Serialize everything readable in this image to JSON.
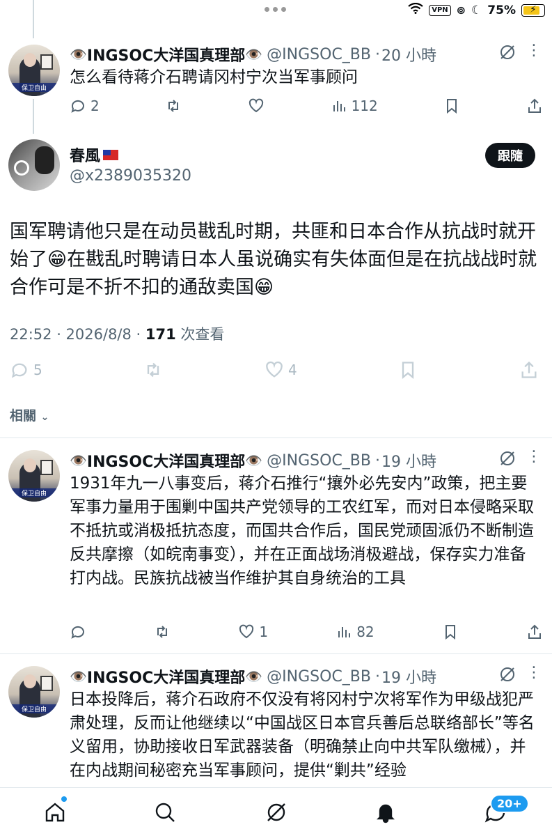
{
  "status_bar": {
    "vpn": "VPN",
    "battery": "75%"
  },
  "tweets_top": {
    "name": "INGSOC大洋国真理部",
    "handle": "@INGSOC_BB",
    "time": "20 小時",
    "text": "怎么看待蒋介石聘请冈村宁次当军事顾问",
    "replies": "2",
    "retweets": "",
    "likes": "",
    "views": "112",
    "avatar_tag": "保卫自由"
  },
  "main_tweet": {
    "name": "春風",
    "handle": "@x2389035320",
    "follow_label": "跟隨",
    "text": "国军聘请他只是在动员戡乱时期，共匪和日本合作从抗战时就开始了😁在戡乱时聘请日本人虽说确实有失体面但是在抗战战时就合作可是不折不扣的通敌卖国😁",
    "time": "22:52 · 2026/8/8 · ",
    "views": "171",
    "views_label": " 次查看",
    "replies": "5",
    "likes": "4"
  },
  "related_label": "相關",
  "replies": [
    {
      "name": "INGSOC大洋国真理部",
      "handle": "@INGSOC_BB",
      "time": "19 小時",
      "text": "1931年九一八事变后，蒋介石推行“攘外必先安内”政策，把主要军事力量用于围剿中国共产党领导的工农红军，而对日本侵略采取不抵抗或消极抵抗态度，而国共合作后，国民党顽固派仍不断制造反共摩擦（如皖南事变），并在正面战场消极避战，保存实力准备打内战。民族抗战被当作维护其自身统治的工具",
      "replies": "",
      "likes": "1",
      "views": "82"
    },
    {
      "name": "INGSOC大洋国真理部",
      "handle": "@INGSOC_BB",
      "time": "19 小時",
      "text": "日本投降后，蒋介石政府不仅没有将冈村宁次将军作为甲级战犯严肃处理，反而让他继续以“中国战区日本官兵善后总联络部长”等名义留用，协助接收日军武器装备（明确禁止向中共军队缴械），并在内战期间秘密充当军事顾问，提供“剿共”经验"
    }
  ],
  "bottom_nav": {
    "messages_badge": "20+"
  },
  "colors": {
    "accent": "#1d9bf0",
    "text": "#0f1419",
    "muted": "#536471"
  }
}
